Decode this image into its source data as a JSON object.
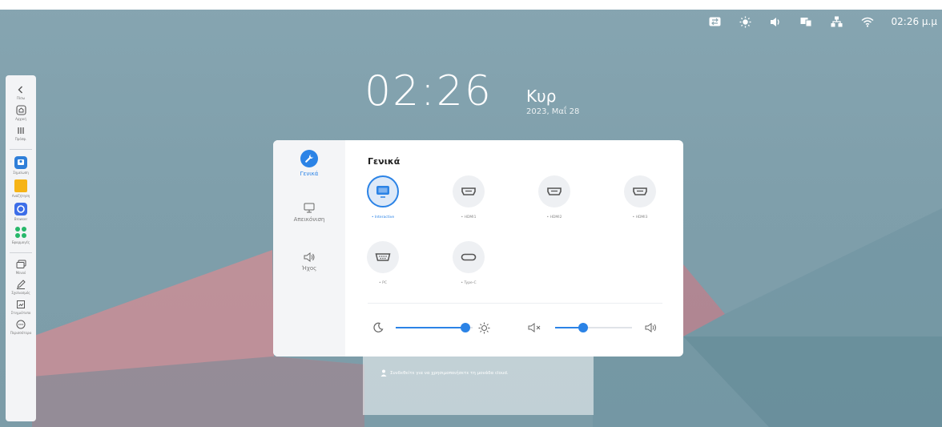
{
  "status": {
    "time": "02:26 μ.μ"
  },
  "clock": {
    "time": "02:26",
    "day": "Κυρ",
    "date": "2023, Μαΐ 28"
  },
  "sidebar": {
    "items": [
      {
        "label": "Πίσω",
        "icon": "chevron-left-icon"
      },
      {
        "label": "Αρχική",
        "icon": "home-icon"
      },
      {
        "label": "Πρόσφ.",
        "icon": "recent-apps-icon"
      },
      {
        "label": "Σημείωση",
        "icon": "whiteboard-app-icon"
      },
      {
        "label": "Ανάζήτηση",
        "icon": "folder-app-icon"
      },
      {
        "label": "Browser",
        "icon": "browser-app-icon"
      },
      {
        "label": "Εφαρμογές",
        "icon": "apps-grid-icon"
      },
      {
        "label": "Μενού",
        "icon": "windows-icon"
      },
      {
        "label": "Σχολιασμός",
        "icon": "annotate-pen-icon"
      },
      {
        "label": "Στιγμιότυπο",
        "icon": "screenshot-icon"
      },
      {
        "label": "Περισσότερα",
        "icon": "more-icon"
      }
    ]
  },
  "panel": {
    "title": "Γενικά",
    "nav": [
      {
        "label": "Γενικά",
        "icon": "wrench-icon",
        "active": true
      },
      {
        "label": "Απεικόνιση",
        "icon": "monitor-icon",
        "active": false
      },
      {
        "label": "Ήχος",
        "icon": "speaker-icon",
        "active": false
      }
    ],
    "sources": [
      {
        "label": "• Interactive",
        "icon": "screen-icon",
        "active": true
      },
      {
        "label": "• HDMI1",
        "icon": "hdmi-port-icon",
        "active": false
      },
      {
        "label": "• HDMI2",
        "icon": "hdmi-port-icon",
        "active": false
      },
      {
        "label": "• HDMI3",
        "icon": "hdmi-port-icon",
        "active": false
      },
      {
        "label": "• PC",
        "icon": "vga-port-icon",
        "active": false
      },
      {
        "label": "• Type-C",
        "icon": "usb-c-port-icon",
        "active": false
      }
    ],
    "brightness": 0.96,
    "volume": 0.35
  },
  "card": {
    "message": "Συνδεθείτε για να χρησιμοποιήσετε τη μονάδα cloud."
  },
  "colors": {
    "accent": "#2b83e6",
    "panel_bg": "#ffffff",
    "nav_bg": "#f4f5f7"
  }
}
